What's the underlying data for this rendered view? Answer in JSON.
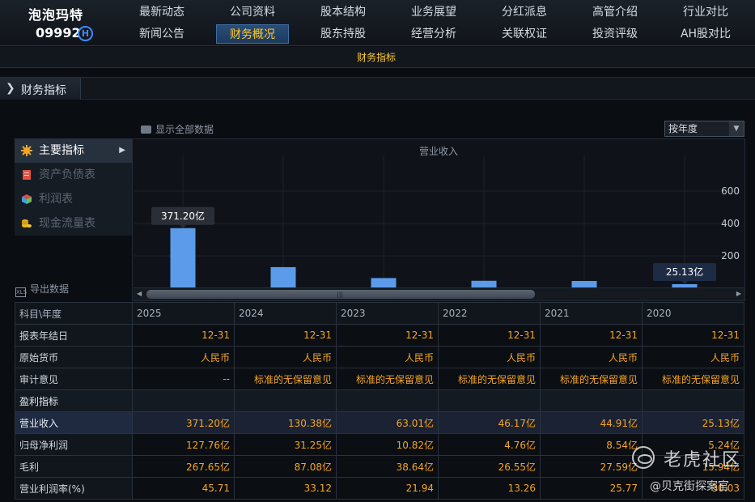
{
  "brand": {
    "name": "泡泡玛特",
    "code": "09992",
    "market_badge": "H"
  },
  "nav": {
    "row1": [
      "最新动态",
      "公司资料",
      "股本结构",
      "业务展望",
      "分红派息",
      "高管介绍",
      "行业对比"
    ],
    "row2": [
      "新闻公告",
      "财务概况",
      "股东持股",
      "经营分析",
      "关联权证",
      "投资评级",
      "AH股对比"
    ],
    "active": "财务概况"
  },
  "subnav": {
    "items": [
      "财务指标"
    ]
  },
  "section": {
    "title": "财务指标"
  },
  "controls": {
    "show_all": "显示全部数据",
    "period_select": "按年度",
    "export": "导出数据"
  },
  "side_menu": [
    {
      "label": "主要指标",
      "icon": "gear-icon",
      "active": true
    },
    {
      "label": "资产负债表",
      "icon": "document-icon",
      "active": false
    },
    {
      "label": "利润表",
      "icon": "cube-icon",
      "active": false
    },
    {
      "label": "现金流量表",
      "icon": "coins-icon",
      "active": false
    }
  ],
  "chart_data": {
    "type": "bar",
    "title": "营业收入",
    "categories": [
      "2025",
      "2024",
      "2023",
      "2022",
      "2021",
      "2020"
    ],
    "values": [
      371.2,
      130.38,
      63.01,
      46.17,
      44.91,
      25.13
    ],
    "unit": "亿",
    "yticks": [
      200,
      400,
      600
    ],
    "ylim": [
      0,
      700
    ],
    "labels_shown": [
      {
        "index": 0,
        "text": "371.20亿"
      },
      {
        "index": 5,
        "text": "25.13亿"
      }
    ],
    "bar_color": "#5b9bea",
    "grid": true
  },
  "table": {
    "header": [
      "科目\\年度",
      "2025",
      "2024",
      "2023",
      "2022",
      "2021",
      "2020"
    ],
    "rows": [
      {
        "label": "报表年结日",
        "values": [
          "12-31",
          "12-31",
          "12-31",
          "12-31",
          "12-31",
          "12-31"
        ]
      },
      {
        "label": "原始货币",
        "values": [
          "人民币",
          "人民币",
          "人民币",
          "人民币",
          "人民币",
          "人民币"
        ]
      },
      {
        "label": "审计意见",
        "values": [
          "--",
          "标准的无保留意见",
          "标准的无保留意见",
          "标准的无保留意见",
          "标准的无保留意见",
          "标准的无保留意见"
        ]
      },
      {
        "label": "盈利指标",
        "values": [
          "",
          "",
          "",
          "",
          "",
          ""
        ],
        "section": true
      },
      {
        "label": "营业收入",
        "values": [
          "371.20亿",
          "130.38亿",
          "63.01亿",
          "46.17亿",
          "44.91亿",
          "25.13亿"
        ],
        "highlight": true
      },
      {
        "label": "归母净利润",
        "values": [
          "127.76亿",
          "31.25亿",
          "10.82亿",
          "4.76亿",
          "8.54亿",
          "5.24亿"
        ]
      },
      {
        "label": "毛利",
        "values": [
          "267.65亿",
          "87.08亿",
          "38.64亿",
          "26.55亿",
          "27.59亿",
          "15.94亿"
        ]
      },
      {
        "label": "营业利润率(%)",
        "values": [
          "45.71",
          "33.12",
          "21.94",
          "13.26",
          "25.77",
          "30.03"
        ]
      }
    ]
  },
  "watermark": {
    "main": "老虎社区",
    "sub": "@贝克街探案官"
  },
  "colors": {
    "accent": "#ffcb2e",
    "value": "#f5a623",
    "bar": "#5b9bea"
  }
}
